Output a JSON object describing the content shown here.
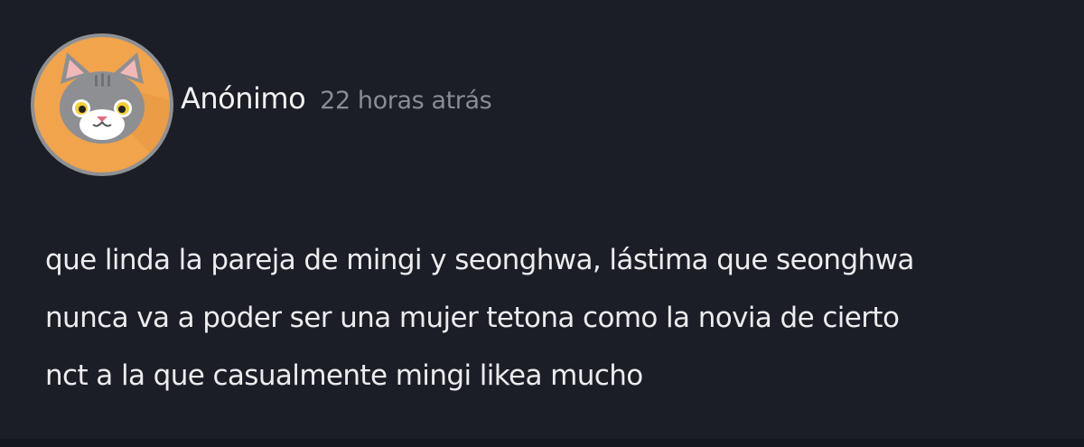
{
  "post": {
    "author": "Anónimo",
    "time": "22 horas atrás",
    "message_lines": [
      "que linda la pareja de mingi y seonghwa, lástima que seonghwa",
      "nunca va a poder ser una mujer tetona como la novia de cierto",
      "nct a la que casualmente mingi likea mucho"
    ],
    "avatar_icon": "cat-icon"
  },
  "colors": {
    "background": "#1b1d27",
    "avatar_bg": "#f1a44c",
    "avatar_border": "#8f9093",
    "author_text": "#f2f2f2",
    "time_text": "#8a8c93",
    "message_text": "#ececee"
  }
}
